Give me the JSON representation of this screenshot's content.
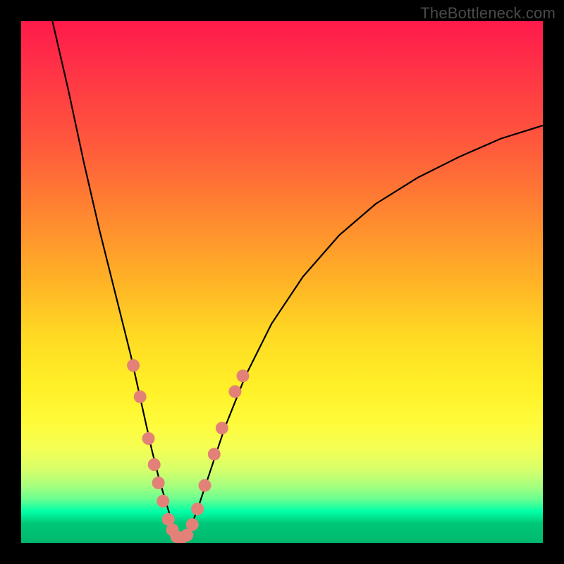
{
  "watermark": "TheBottleneck.com",
  "colors": {
    "curve": "#000000",
    "dot_fill": "#e38178",
    "dot_stroke": "#c96a61",
    "bg_black": "#000000"
  },
  "chart_data": {
    "type": "line",
    "title": "",
    "xlabel": "",
    "ylabel": "",
    "xlim": [
      0,
      100
    ],
    "ylim": [
      0,
      100
    ],
    "grid": false,
    "legend": false,
    "series": [
      {
        "name": "bottleneck-curve",
        "x": [
          6,
          9,
          12,
          15,
          18,
          21,
          23,
          25,
          26.5,
          28,
          29.2,
          30,
          31,
          32.5,
          34,
          36,
          39,
          43,
          48,
          54,
          61,
          68,
          76,
          84,
          92,
          100
        ],
        "y": [
          100,
          87,
          73,
          60,
          48,
          36,
          27,
          18,
          12,
          7,
          3,
          1,
          1,
          3,
          7,
          13,
          22,
          32,
          42,
          51,
          59,
          65,
          70,
          74,
          77.5,
          80
        ]
      }
    ],
    "dots": {
      "name": "sample-points",
      "points": [
        {
          "x": 21.5,
          "y": 34
        },
        {
          "x": 22.8,
          "y": 28
        },
        {
          "x": 24.4,
          "y": 20
        },
        {
          "x": 25.5,
          "y": 15
        },
        {
          "x": 26.3,
          "y": 11.5
        },
        {
          "x": 27.2,
          "y": 8
        },
        {
          "x": 28.2,
          "y": 4.5
        },
        {
          "x": 29.0,
          "y": 2.5
        },
        {
          "x": 29.8,
          "y": 1.2
        },
        {
          "x": 30.8,
          "y": 1.0
        },
        {
          "x": 31.8,
          "y": 1.5
        },
        {
          "x": 32.8,
          "y": 3.5
        },
        {
          "x": 33.8,
          "y": 6.5
        },
        {
          "x": 35.2,
          "y": 11
        },
        {
          "x": 37.0,
          "y": 17
        },
        {
          "x": 38.5,
          "y": 22
        },
        {
          "x": 41.0,
          "y": 29
        },
        {
          "x": 42.5,
          "y": 32
        }
      ],
      "radius_px": 9
    }
  }
}
